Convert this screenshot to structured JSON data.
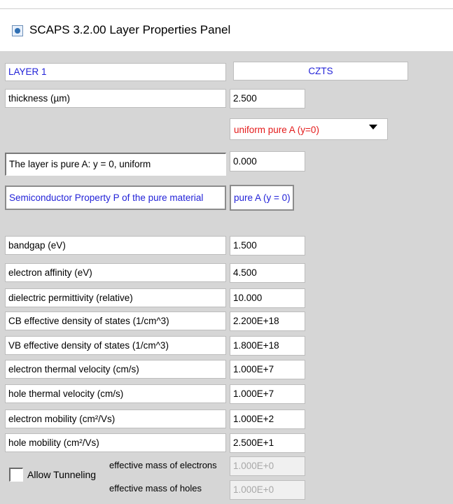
{
  "window": {
    "title": "SCAPS 3.2.00 Layer Properties Panel"
  },
  "layer": {
    "label": "LAYER 1",
    "name": "CZTS"
  },
  "thickness": {
    "label": "thickness (µm)",
    "value": "2.500"
  },
  "composition": {
    "dropdown_value": "uniform pure A (y=0)",
    "pure_label": "The layer is pure A: y = 0, uniform",
    "pure_value": "0.000",
    "property_label": "Semiconductor Property P of the pure material",
    "property_value": "pure A (y = 0)"
  },
  "properties": [
    {
      "label": "bandgap (eV)",
      "value": "1.500"
    },
    {
      "label": "electron affinity (eV)",
      "value": "4.500"
    },
    {
      "label": "dielectric permittivity (relative)",
      "value": "10.000"
    },
    {
      "label": "CB effective density of states (1/cm^3)",
      "value": "2.200E+18"
    },
    {
      "label": "VB effective density of states (1/cm^3)",
      "value": "1.800E+18"
    },
    {
      "label": "electron thermal velocity (cm/s)",
      "value": "1.000E+7"
    },
    {
      "label": "hole thermal velocity (cm/s)",
      "value": "1.000E+7"
    },
    {
      "label": "electron mobility (cm²/Vs)",
      "value": "1.000E+2"
    },
    {
      "label": "hole mobility (cm²/Vs)",
      "value": "2.500E+1"
    }
  ],
  "tunneling": {
    "checkbox_label": "Allow Tunneling",
    "checked": false,
    "electron_mass_label": "effective mass of electrons",
    "electron_mass_value": "1.000E+0",
    "hole_mass_label": "effective mass of holes",
    "hole_mass_value": "1.000E+0"
  },
  "colors": {
    "panel_bg": "#d6d6d6",
    "label_blue": "#2323d8",
    "dropdown_red": "#e41b1b"
  }
}
